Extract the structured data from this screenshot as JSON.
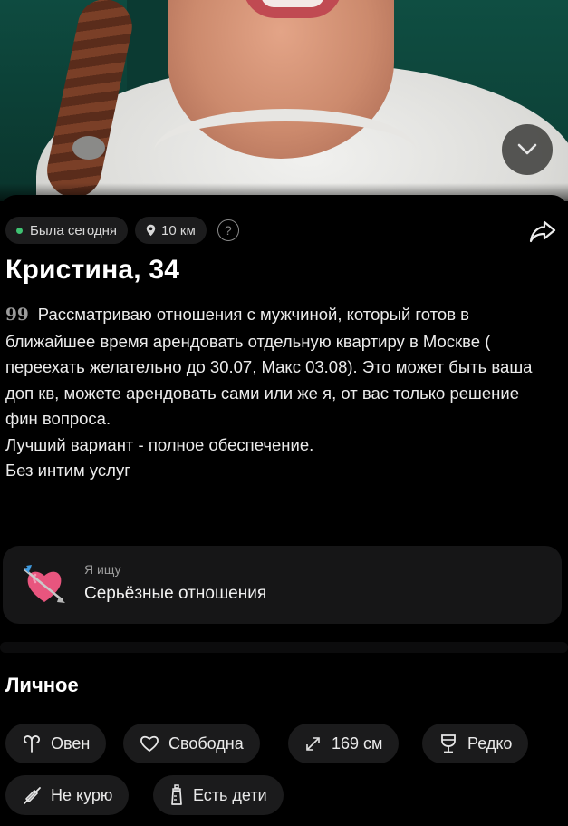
{
  "profile": {
    "status_online": "Была сегодня",
    "distance": "10 км",
    "help": "?",
    "name_age": "Кристина, 34",
    "bio_lines": [
      "Рассматриваю отношения с мужчиной, который готов в ближайшее время арендовать отдельную квартиру в Москве ( переехать желательно до 30.07, Макс 03.08). Это может быть ваша доп кв, можете арендовать сами или же я, от вас только решение фин вопроса.",
      "Лучший вариант - полное обеспечение.",
      "Без интим услуг"
    ],
    "quote_glyph": "99"
  },
  "seeking": {
    "label": "Я ищу",
    "value": "Серьёзные отношения",
    "icon": "heart-with-arrow-icon"
  },
  "personal": {
    "title": "Личное",
    "chips": [
      {
        "label": "Овен",
        "icon": "aries-icon"
      },
      {
        "label": "Свободна",
        "icon": "heart-outline-icon"
      },
      {
        "label": "169 см",
        "icon": "height-arrow-icon"
      },
      {
        "label": "Редко",
        "icon": "wine-glass-icon"
      },
      {
        "label": "Не курю",
        "icon": "no-smoking-icon"
      },
      {
        "label": "Есть дети",
        "icon": "baby-bottle-icon"
      }
    ]
  },
  "colors": {
    "background": "#000000",
    "card": "#161617",
    "chip": "#1b1b1c",
    "online_dot": "#3fc272",
    "heart": "#e8557e"
  }
}
